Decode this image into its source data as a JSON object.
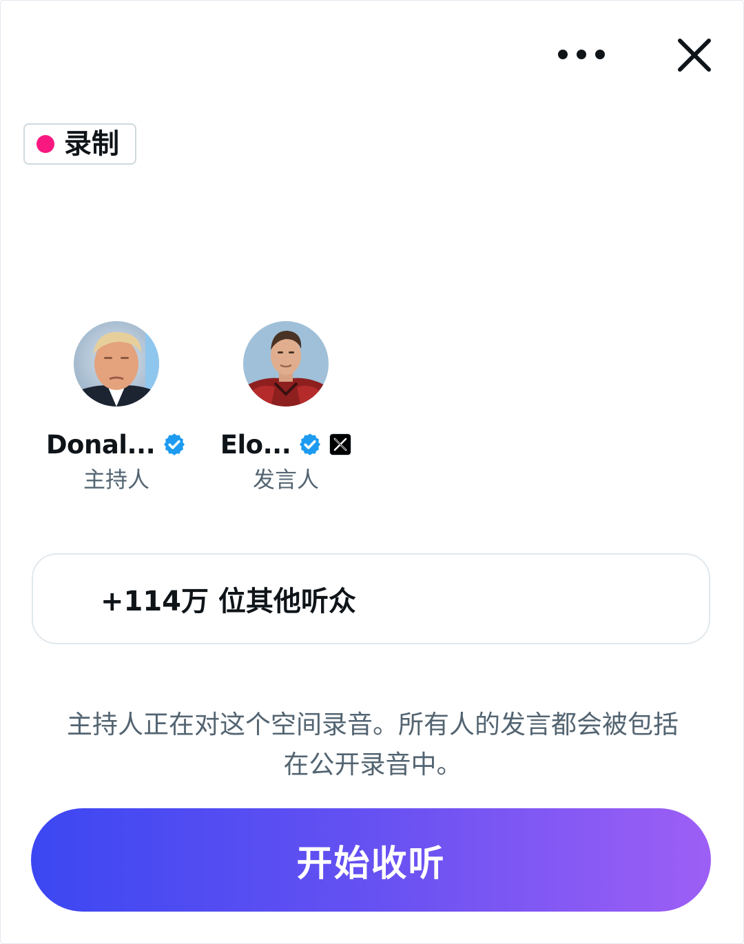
{
  "header": {
    "more_icon": "more-horizontal-icon",
    "close_icon": "close-icon"
  },
  "recording_badge": {
    "label": "录制",
    "dot_color": "#f91880"
  },
  "participants": [
    {
      "name": "Donal...",
      "role": "主持人",
      "verified_icon": "verified-badge-icon",
      "avatar_icon": "avatar-photo"
    },
    {
      "name": "Elo...",
      "role": "发言人",
      "verified_icon": "verified-badge-icon",
      "affiliation_icon": "x-logo-icon",
      "avatar_icon": "avatar-photo"
    }
  ],
  "listeners": {
    "text": "+114万 位其他听众"
  },
  "notice": {
    "line1": "主持人正在对这个空间录音。所有人的发言都会被包括",
    "line2": "在公开录音中。"
  },
  "cta": {
    "label": "开始收听",
    "gradient_start": "#3c47f2",
    "gradient_end": "#9d5ff5"
  },
  "colors": {
    "text_primary": "#0f1419",
    "text_secondary": "#536471",
    "verified_blue": "#1d9bf0",
    "border": "#e1e8ed"
  }
}
